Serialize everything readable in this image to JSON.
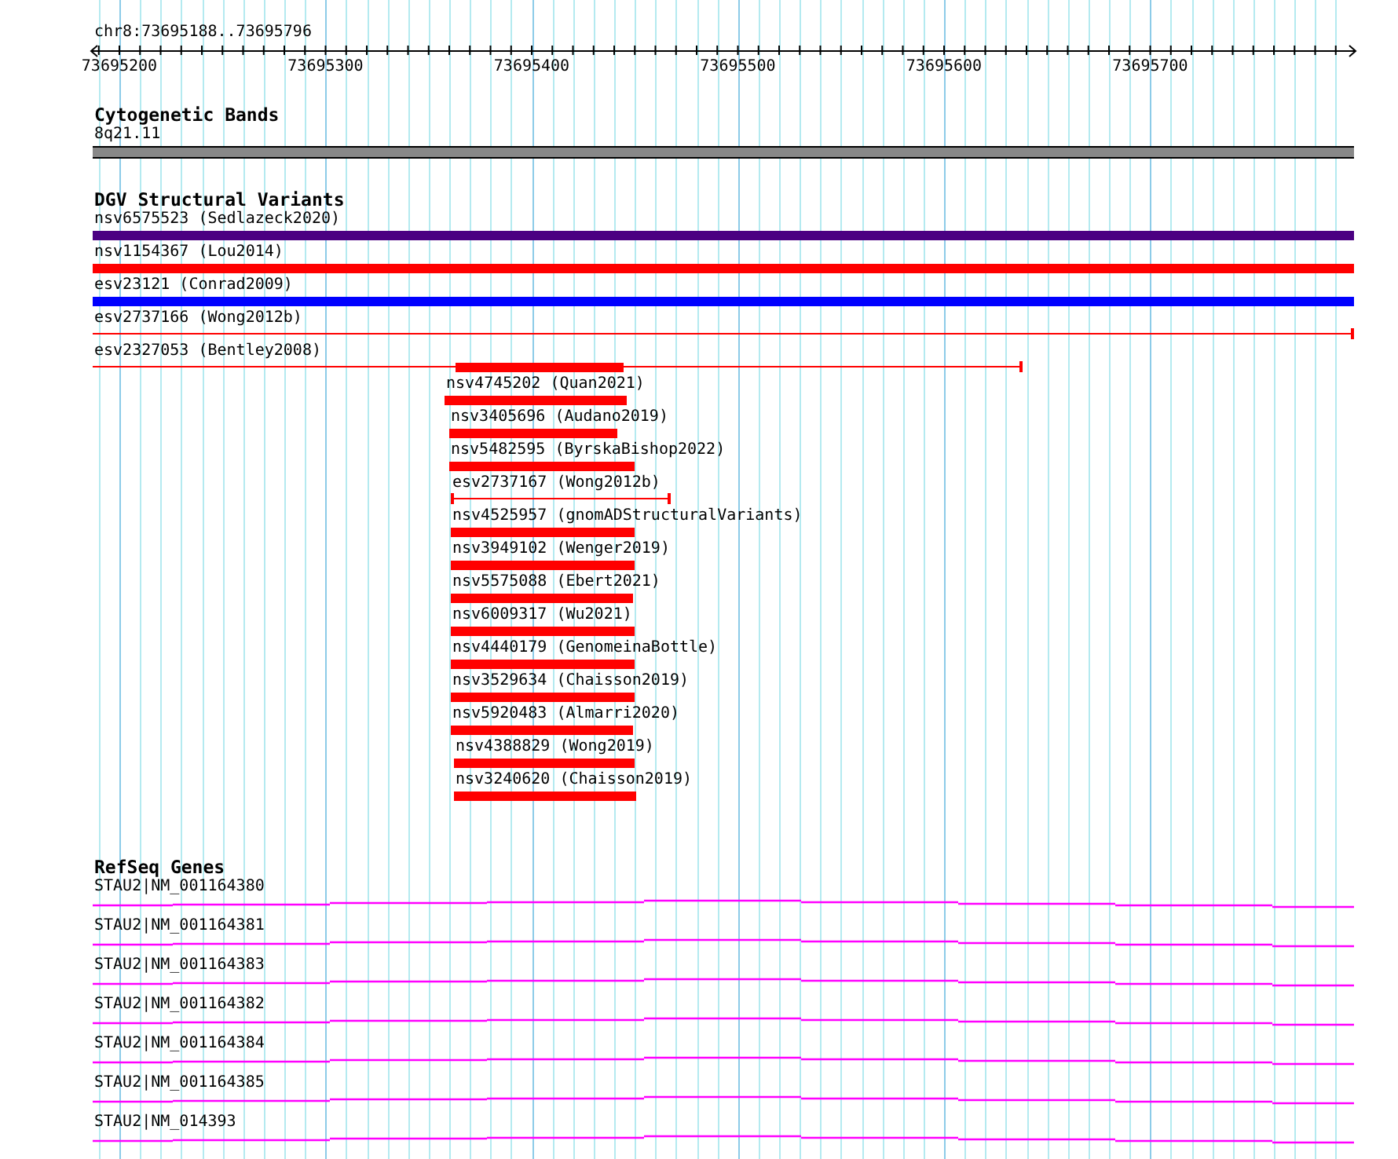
{
  "location": "chr8:73695188..73695796",
  "ruler": {
    "ticks": [
      "73695200",
      "73695300",
      "73695400",
      "73695500",
      "73695600",
      "73695700"
    ]
  },
  "tracks": [
    {
      "kind": "cytoband",
      "title": "Cytogenetic Bands",
      "features": [
        {
          "label": "8q21.11"
        }
      ]
    },
    {
      "kind": "variants",
      "title": "DGV Structural Variants",
      "features": [
        {
          "label": "nsv6575523 (Sedlazeck2020)",
          "kind": "bar",
          "color": "#4b0082"
        },
        {
          "label": "nsv1154367 (Lou2014)",
          "kind": "bar",
          "color": "#ff0000"
        },
        {
          "label": "esv23121 (Conrad2009)",
          "kind": "bar",
          "color": "#0000ff"
        },
        {
          "label": "esv2737166 (Wong2012b)",
          "kind": "line",
          "color": "#ff0000"
        },
        {
          "label": "esv2327053 (Bentley2008)",
          "kind": "line",
          "color": "#ff0000"
        },
        {
          "kind": "bar",
          "color": "#ff0000"
        },
        {
          "label": "nsv4745202 (Quan2021)",
          "kind": "bar",
          "color": "#ff0000"
        },
        {
          "label": "nsv3405696 (Audano2019)",
          "kind": "bar",
          "color": "#ff0000"
        },
        {
          "label": "nsv5482595 (ByrskaBishop2022)",
          "kind": "bar",
          "color": "#ff0000"
        },
        {
          "label": "esv2737167 (Wong2012b)",
          "kind": "line",
          "color": "#ff0000"
        },
        {
          "label": "nsv4525957 (gnomADStructuralVariants)",
          "kind": "bar",
          "color": "#ff0000"
        },
        {
          "label": "nsv3949102 (Wenger2019)",
          "kind": "bar",
          "color": "#ff0000"
        },
        {
          "label": "nsv5575088 (Ebert2021)",
          "kind": "bar",
          "color": "#ff0000"
        },
        {
          "label": "nsv6009317 (Wu2021)",
          "kind": "bar",
          "color": "#ff0000"
        },
        {
          "label": "nsv4440179 (GenomeinaBottle)",
          "kind": "bar",
          "color": "#ff0000"
        },
        {
          "label": "nsv3529634 (Chaisson2019)",
          "kind": "bar",
          "color": "#ff0000"
        },
        {
          "label": "nsv5920483 (Almarri2020)",
          "kind": "bar",
          "color": "#ff0000"
        },
        {
          "label": "nsv4388829 (Wong2019)",
          "kind": "bar",
          "color": "#ff0000"
        },
        {
          "label": "nsv3240620 (Chaisson2019)",
          "kind": "bar",
          "color": "#ff0000"
        }
      ]
    },
    {
      "kind": "genes",
      "title": "RefSeq Genes",
      "features": [
        {
          "label": "STAU2|NM_001164380"
        },
        {
          "label": "STAU2|NM_001164381"
        },
        {
          "label": "STAU2|NM_001164383"
        },
        {
          "label": "STAU2|NM_001164382"
        },
        {
          "label": "STAU2|NM_001164384"
        },
        {
          "label": "STAU2|NM_001164385"
        },
        {
          "label": "STAU2|NM_014393"
        }
      ]
    }
  ]
}
